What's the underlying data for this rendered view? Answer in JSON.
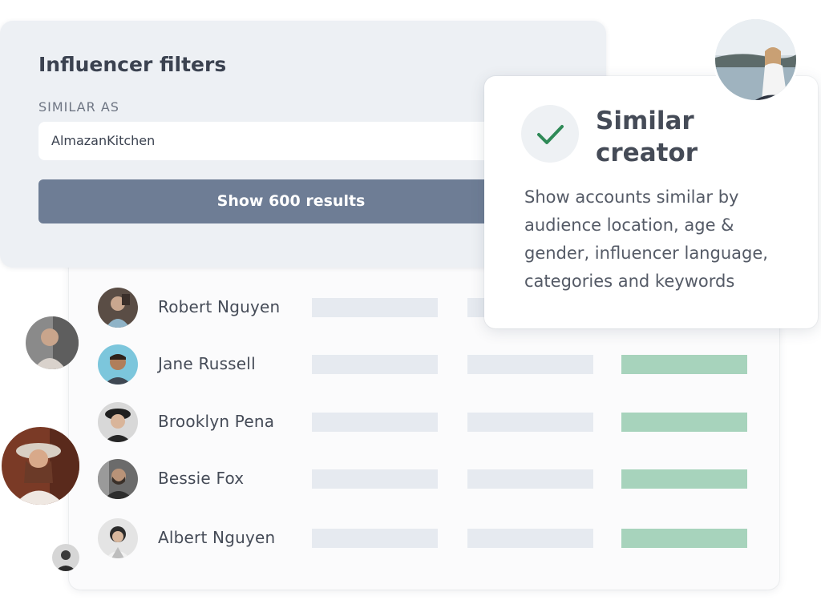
{
  "filters": {
    "title": "Influencer filters",
    "similar_label": "SIMILAR AS",
    "similar_value": "AlmazanKitchen",
    "show_button": "Show 600 results"
  },
  "similar_creator": {
    "title": "Similar creator",
    "description": "Show accounts similar by audience location, age & gender, influencer language, categories and keywords",
    "check_icon": "check-icon"
  },
  "results": [
    {
      "name": "Robert Nguyen"
    },
    {
      "name": "Jane Russell"
    },
    {
      "name": "Brooklyn Pena"
    },
    {
      "name": "Bessie Fox"
    },
    {
      "name": "Albert Nguyen"
    }
  ],
  "colors": {
    "accent_green": "#a7d3bc",
    "placeholder_bar": "#e6eaf0",
    "button": "#6e7d95",
    "check": "#2f8a57"
  }
}
